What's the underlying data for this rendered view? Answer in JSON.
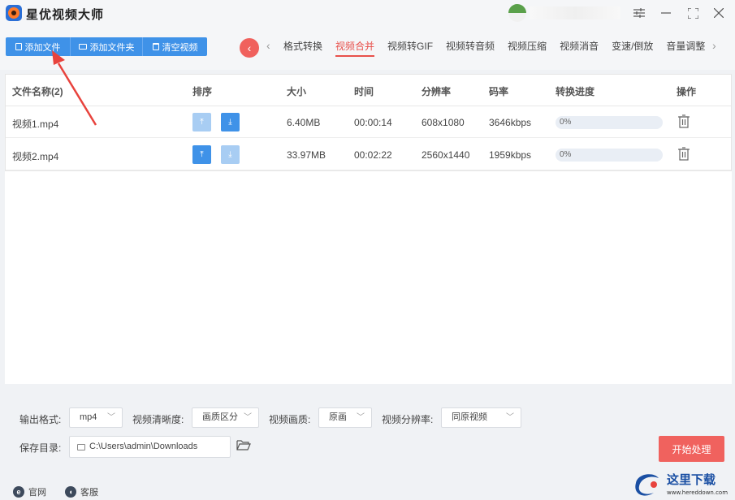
{
  "app": {
    "title": "星优视频大师"
  },
  "window": {
    "settings_icon": "sliders-icon",
    "minimize_icon": "minimize-icon",
    "maximize_icon": "maximize-icon",
    "close_icon": "close-icon"
  },
  "toolbar": {
    "add_file": "添加文件",
    "add_folder": "添加文件夹",
    "clear_videos": "清空视频"
  },
  "tabs": [
    {
      "label": "格式转换",
      "active": false
    },
    {
      "label": "视频合并",
      "active": true
    },
    {
      "label": "视频转GIF",
      "active": false
    },
    {
      "label": "视频转音频",
      "active": false
    },
    {
      "label": "视频压缩",
      "active": false
    },
    {
      "label": "视频消音",
      "active": false
    },
    {
      "label": "变速/倒放",
      "active": false
    },
    {
      "label": "音量调整",
      "active": false
    }
  ],
  "table": {
    "headers": {
      "name": "文件名称(2)",
      "sort": "排序",
      "size": "大小",
      "time": "时间",
      "resolution": "分辨率",
      "bitrate": "码率",
      "progress": "转换进度",
      "actions": "操作"
    },
    "rows": [
      {
        "name": "视频1.mp4",
        "size": "6.40MB",
        "time": "00:00:14",
        "resolution": "608x1080",
        "bitrate": "3646kbps",
        "progress": "0%",
        "progress_value": 0
      },
      {
        "name": "视频2.mp4",
        "size": "33.97MB",
        "time": "00:02:22",
        "resolution": "2560x1440",
        "bitrate": "1959kbps",
        "progress": "0%",
        "progress_value": 0
      }
    ]
  },
  "settings": {
    "output_format_label": "输出格式:",
    "output_format_value": "mp4",
    "clarity_label": "视频清晰度:",
    "clarity_value": "画质区分",
    "quality_label": "视频画质:",
    "quality_value": "原画",
    "resolution_label": "视频分辨率:",
    "resolution_value": "同原视频",
    "save_dir_label": "保存目录:",
    "save_dir_value": "C:\\Users\\admin\\Downloads",
    "start_button": "开始处理"
  },
  "statusbar": {
    "website": "官网",
    "support": "客服"
  },
  "colors": {
    "primary": "#3f92e8",
    "accent": "#f0625e",
    "tab_active": "#e8504b"
  },
  "watermark": {
    "brand": "这里下载",
    "url": "www.hereddown.com"
  }
}
